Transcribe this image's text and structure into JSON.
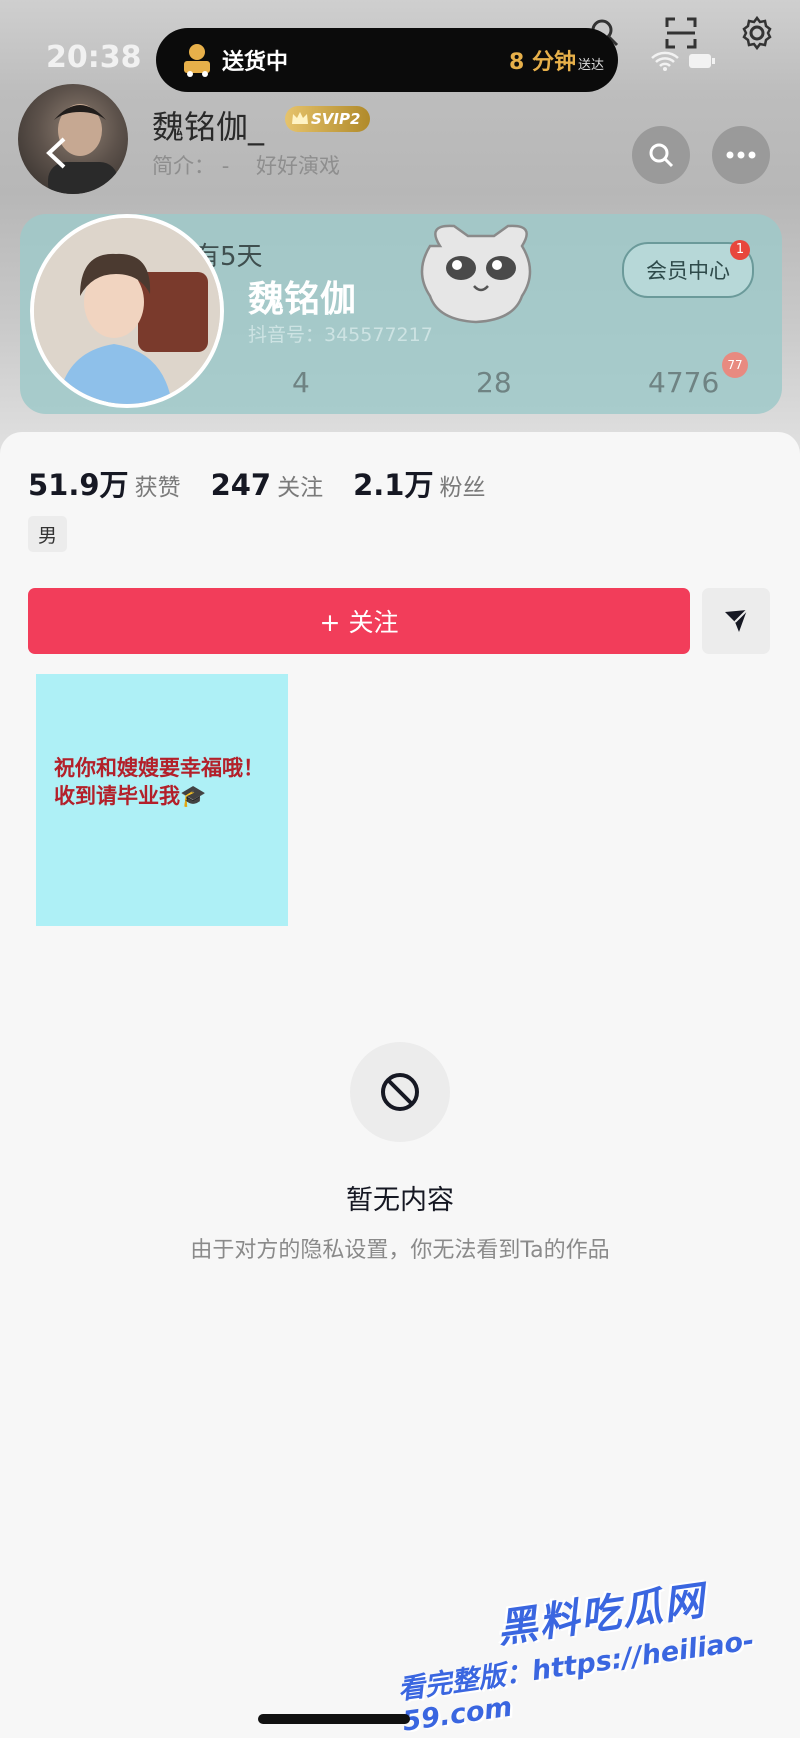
{
  "status_bar": {
    "time": "20:38"
  },
  "delivery_pill": {
    "label": "送货中",
    "eta_value": "8 分钟",
    "eta_suffix": "送达",
    "icon": "delivery-truck-icon"
  },
  "header": {
    "username": "魏铭伽_",
    "badge": "SVIP2",
    "bio_label": "简介：",
    "bio_dash": "-",
    "bio_text": "好好演戏",
    "buttons": [
      "search-icon",
      "more-icon"
    ],
    "top_icons": [
      "search-icon",
      "scan-icon",
      "settings-icon"
    ]
  },
  "member_card": {
    "days": "有5天",
    "name": "魏铭伽",
    "account_id": "抖音号：345577217",
    "vip_center": "会员中心",
    "vip_badge": "1",
    "stats": [
      "4",
      "28",
      "4776"
    ],
    "stat_badge": "77"
  },
  "profile": {
    "likes_num": "51.9万",
    "likes_label": "获赞",
    "following_num": "247",
    "following_label": "关注",
    "followers_num": "2.1万",
    "followers_label": "粉丝",
    "gender": "男"
  },
  "actions": {
    "follow": "+ 关注"
  },
  "thumbnail": {
    "line1": "祝你和嫂嫂要幸福哦！",
    "line2": "收到请毕业我🎓"
  },
  "empty_state": {
    "title": "暂无内容",
    "description": "由于对方的隐私设置，你无法看到Ta的作品",
    "icon": "blocked-icon"
  },
  "watermark": {
    "line1": "黑料吃瓜网",
    "line2": "看完整版：https://heiliao-59.com"
  },
  "colors": {
    "follow_button": "#f23d5a",
    "thumbnail_bg": "#aef0f6",
    "watermark": "#3a66e0"
  }
}
